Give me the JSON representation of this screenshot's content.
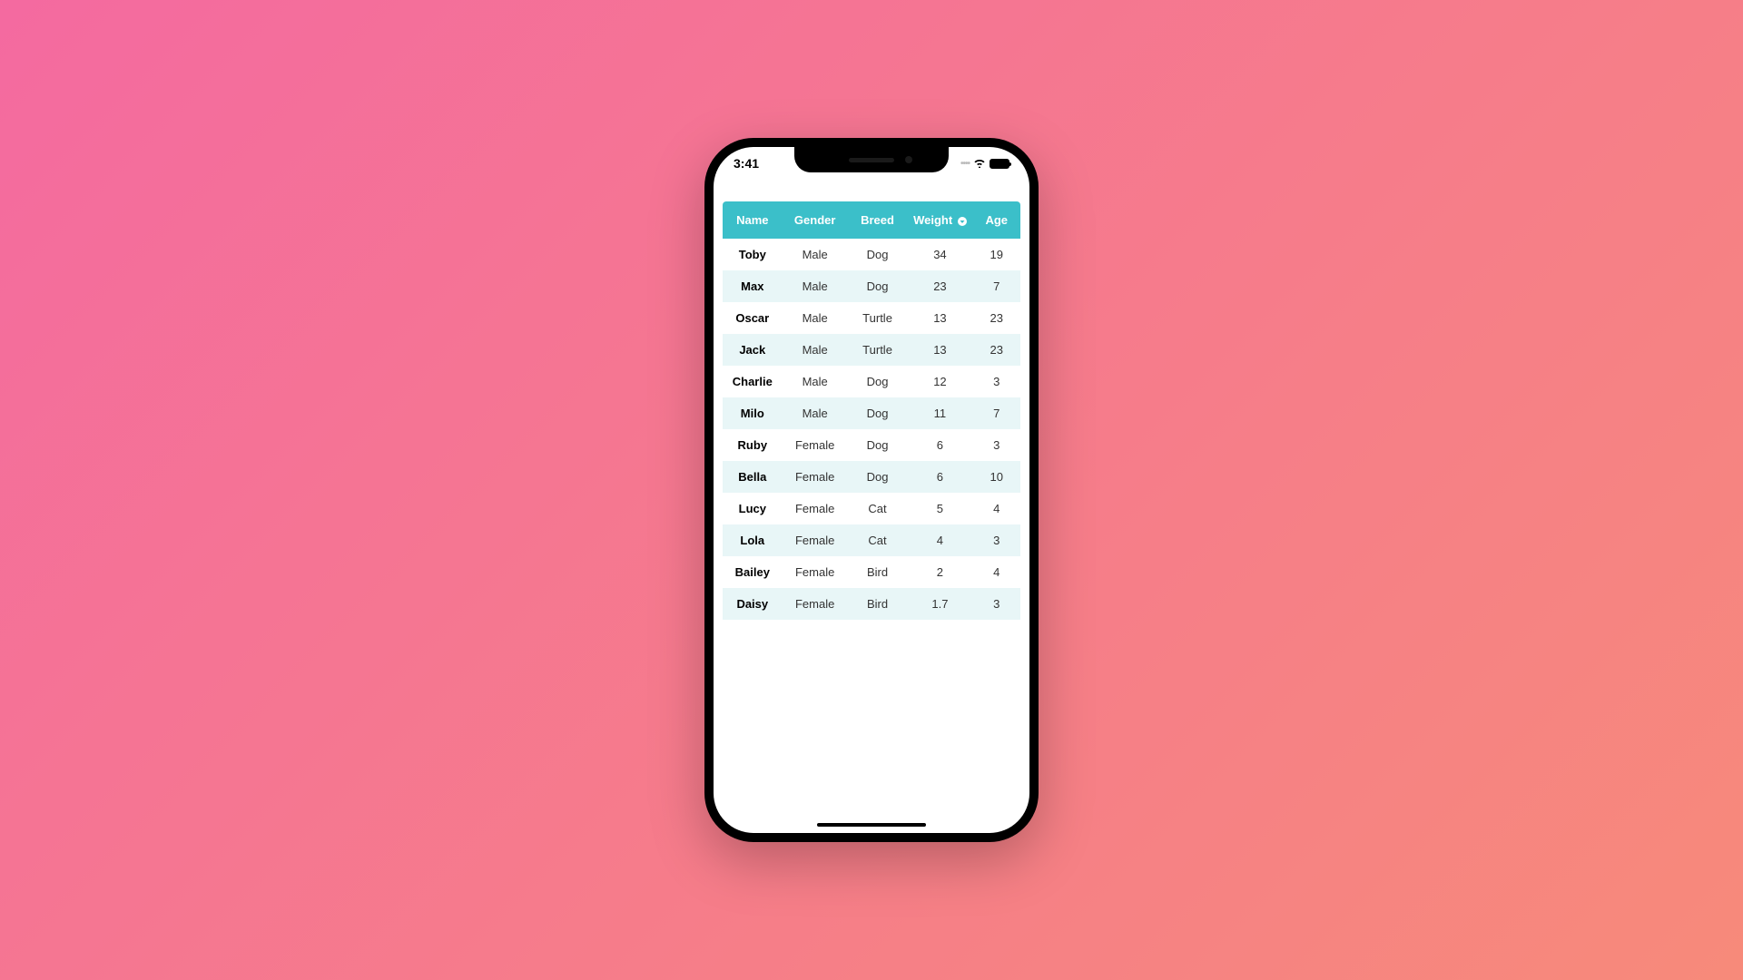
{
  "status": {
    "time": "3:41"
  },
  "table": {
    "headers": {
      "name": "Name",
      "gender": "Gender",
      "breed": "Breed",
      "weight": "Weight",
      "age": "Age"
    },
    "sorted_column": "weight",
    "rows": [
      {
        "name": "Toby",
        "gender": "Male",
        "breed": "Dog",
        "weight": "34",
        "age": "19"
      },
      {
        "name": "Max",
        "gender": "Male",
        "breed": "Dog",
        "weight": "23",
        "age": "7"
      },
      {
        "name": "Oscar",
        "gender": "Male",
        "breed": "Turtle",
        "weight": "13",
        "age": "23"
      },
      {
        "name": "Jack",
        "gender": "Male",
        "breed": "Turtle",
        "weight": "13",
        "age": "23"
      },
      {
        "name": "Charlie",
        "gender": "Male",
        "breed": "Dog",
        "weight": "12",
        "age": "3"
      },
      {
        "name": "Milo",
        "gender": "Male",
        "breed": "Dog",
        "weight": "11",
        "age": "7"
      },
      {
        "name": "Ruby",
        "gender": "Female",
        "breed": "Dog",
        "weight": "6",
        "age": "3"
      },
      {
        "name": "Bella",
        "gender": "Female",
        "breed": "Dog",
        "weight": "6",
        "age": "10"
      },
      {
        "name": "Lucy",
        "gender": "Female",
        "breed": "Cat",
        "weight": "5",
        "age": "4"
      },
      {
        "name": "Lola",
        "gender": "Female",
        "breed": "Cat",
        "weight": "4",
        "age": "3"
      },
      {
        "name": "Bailey",
        "gender": "Female",
        "breed": "Bird",
        "weight": "2",
        "age": "4"
      },
      {
        "name": "Daisy",
        "gender": "Female",
        "breed": "Bird",
        "weight": "1.7",
        "age": "3"
      }
    ]
  }
}
